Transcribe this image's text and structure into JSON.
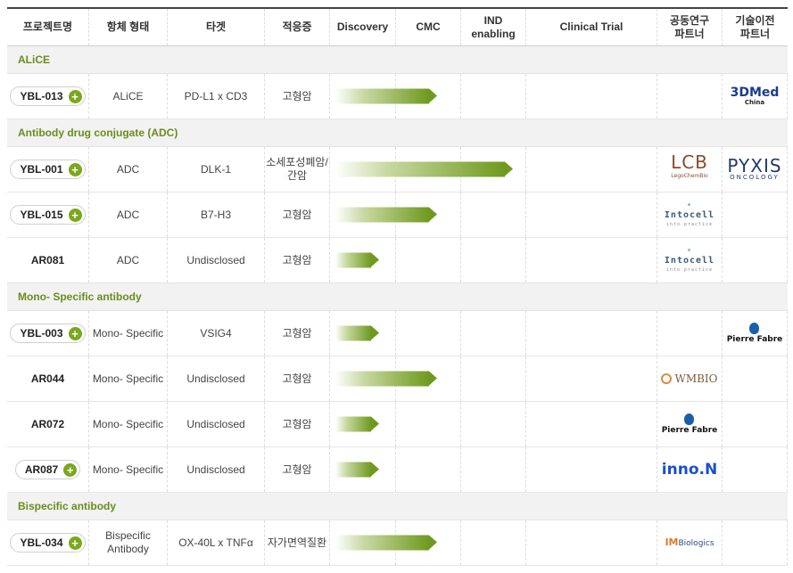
{
  "headers": {
    "project": "프로젝트명",
    "format": "항체 형태",
    "target": "타겟",
    "indication": "적응증",
    "discovery": "Discovery",
    "cmc": "CMC",
    "ind_line1": "IND",
    "ind_line2": "enabling",
    "clinical": "Clinical Trial",
    "partner_line1": "공동연구",
    "partner_line2": "파트너",
    "license_line1": "기술이전",
    "license_line2": "파트너"
  },
  "groups": {
    "alice": "ALiCE",
    "adc": "Antibody drug conjugate (ADC)",
    "mono": "Mono- Specific antibody",
    "bispecific": "Bispecific antibody"
  },
  "rows": {
    "ybl013": {
      "code": "YBL-013",
      "format": "ALiCE",
      "target": "PD-L1 x CD3",
      "indication": "고형암",
      "progress": 0.7
    },
    "ybl001": {
      "code": "YBL-001",
      "format": "ADC",
      "target": "DLK-1",
      "indication_line1": "소세포성폐암/",
      "indication_line2": "간암",
      "progress": 1.22
    },
    "ybl015": {
      "code": "YBL-015",
      "format": "ADC",
      "target": "B7-H3",
      "indication": "고형암",
      "progress": 0.7
    },
    "ar081": {
      "code": "AR081",
      "format": "ADC",
      "target": "Undisclosed",
      "indication": "고형암",
      "progress": 0.3
    },
    "ybl003": {
      "code": "YBL-003",
      "format": "Mono- Specific",
      "target": "VSIG4",
      "indication": "고형암",
      "progress": 0.3
    },
    "ar044": {
      "code": "AR044",
      "format": "Mono- Specific",
      "target": "Undisclosed",
      "indication": "고형암",
      "progress": 0.7
    },
    "ar072": {
      "code": "AR072",
      "format": "Mono- Specific",
      "target": "Undisclosed",
      "indication": "고형암",
      "progress": 0.3
    },
    "ar087": {
      "code": "AR087",
      "format": "Mono- Specific",
      "target": "Undisclosed",
      "indication": "고형암",
      "progress": 0.3
    },
    "ybl034": {
      "code": "YBL-034",
      "format_line1": "Bispecific",
      "format_line2": "Antibody",
      "target": "OX-40L x TNFα",
      "indication": "자가면역질환",
      "progress": 0.7
    }
  },
  "logos": {
    "med3d": "3DMed",
    "med3d_sub": "China",
    "lcb": "LCB",
    "lcb_sub": "LegoChemBio",
    "pyxis": "PYXIS",
    "pyxis_sub": "ONCOLOGY",
    "intocell": "Intocell",
    "intocell_sub": "into practice",
    "pierre": "Pierre Fabre",
    "wmbio": "WMBIO",
    "innon": "inno.N",
    "imbio": "Biologics",
    "imbio_mark": "IM"
  },
  "colors": {
    "accent_green": "#6f9a1f",
    "group_label": "#6a8d1d",
    "plus_badge": "#7aa81e"
  },
  "icons": {
    "expand": "plus-circle-icon"
  }
}
